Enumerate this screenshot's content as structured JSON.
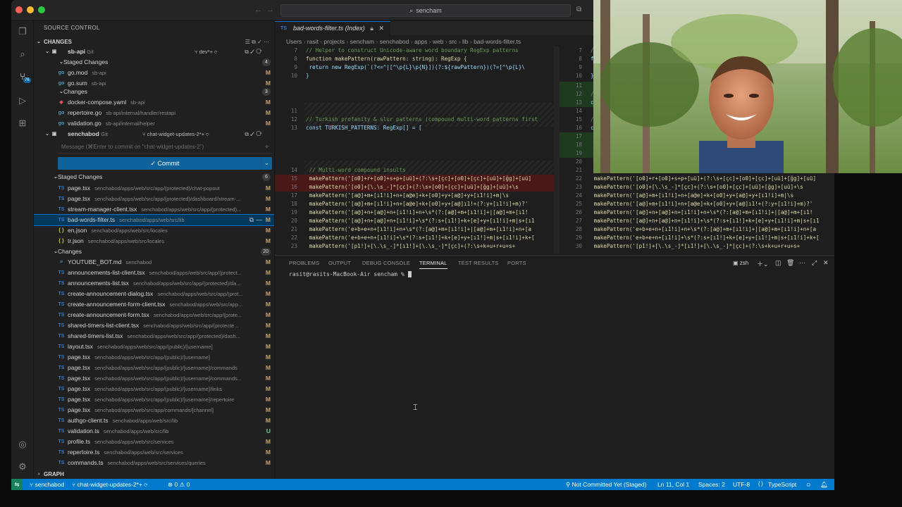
{
  "window": {
    "search_text": "sencham"
  },
  "sidebar": {
    "title": "SOURCE CONTROL",
    "changes_header": "CHANGES",
    "repos": [
      {
        "name": "sb-api",
        "kind": "Git",
        "branch": "dev*+",
        "staged_label": "Staged Changes",
        "staged_count": "4",
        "changes_label": "Changes",
        "changes_count": "3"
      },
      {
        "name": "senchabod",
        "kind": "Git",
        "branch": "chat-widget-updates-2*+",
        "staged_label": "Staged Changes",
        "staged_count": "6",
        "changes_label": "Changes",
        "changes_count": "20"
      }
    ],
    "sbapi_staged": [
      {
        "name": "go.mod",
        "path": "sb-api",
        "status": "M"
      },
      {
        "name": "go.sum",
        "path": "sb-api",
        "status": "M"
      }
    ],
    "sbapi_changes": [
      {
        "name": "docker-compose.yaml",
        "path": "sb-api",
        "status": "M"
      },
      {
        "name": "repertoire.go",
        "path": "sb-api/internal/handler/restapi",
        "status": "M"
      },
      {
        "name": "validation.go",
        "path": "sb-api/internal/helper",
        "status": "M"
      }
    ],
    "commit_placeholder": "Message (⌘Enter to commit on \"chat-widget-updates-2\")",
    "commit_button": "Commit",
    "staged": [
      {
        "name": "page.tsx",
        "path": "senchabod/apps/web/src/app/(protected)/chat-popout",
        "status": "M"
      },
      {
        "name": "page.tsx",
        "path": "senchabod/apps/web/src/app/(protected)/dashboard/stream-...",
        "status": "M"
      },
      {
        "name": "stream-manager-client.tsx",
        "path": "senchabod/apps/web/src/app/(protected)...",
        "status": "M"
      },
      {
        "name": "bad-words-filter.ts",
        "path": "senchabod/apps/web/src/lib",
        "status": "M"
      },
      {
        "name": "en.json",
        "path": "senchabod/apps/web/src/locales",
        "status": "M"
      },
      {
        "name": "tr.json",
        "path": "senchabod/apps/web/src/locales",
        "status": "M"
      }
    ],
    "changes": [
      {
        "name": "YOUTUBE_BOT.md",
        "path": "senchabod",
        "status": "M"
      },
      {
        "name": "announcements-list-client.tsx",
        "path": "senchabod/apps/web/src/app/(protect...",
        "status": "M"
      },
      {
        "name": "announcements-list.tsx",
        "path": "senchabod/apps/web/src/app/(protected)/da...",
        "status": "M"
      },
      {
        "name": "create-announcement-dialog.tsx",
        "path": "senchabod/apps/web/src/app/(prot...",
        "status": "M"
      },
      {
        "name": "create-announcement-form-client.tsx",
        "path": "senchabod/apps/web/src/app...",
        "status": "M"
      },
      {
        "name": "create-announcement-form.tsx",
        "path": "senchabod/apps/web/src/app/(prote...",
        "status": "M"
      },
      {
        "name": "shared-timers-list-client.tsx",
        "path": "senchabod/apps/web/src/app/(protecte...",
        "status": "M"
      },
      {
        "name": "shared-timers-list.tsx",
        "path": "senchabod/apps/web/src/app/(protected)/dash...",
        "status": "M"
      },
      {
        "name": "layout.tsx",
        "path": "senchabod/apps/web/src/app/(public)/[username]",
        "status": "M"
      },
      {
        "name": "page.tsx",
        "path": "senchabod/apps/web/src/app/(public)/[username]",
        "status": "M"
      },
      {
        "name": "page.tsx",
        "path": "senchabod/apps/web/src/app/(public)/[username]/commands",
        "status": "M"
      },
      {
        "name": "page.tsx",
        "path": "senchabod/apps/web/src/app/(public)/[username]/commands...",
        "status": "M"
      },
      {
        "name": "page.tsx",
        "path": "senchabod/apps/web/src/app/(public)/[username]/links",
        "status": "M"
      },
      {
        "name": "page.tsx",
        "path": "senchabod/apps/web/src/app/(public)/[username]/repertoire",
        "status": "M"
      },
      {
        "name": "page.tsx",
        "path": "senchabod/apps/web/src/app/commands/[channel]",
        "status": "M"
      },
      {
        "name": "authgo-client.ts",
        "path": "senchabod/apps/web/src/lib",
        "status": "M"
      },
      {
        "name": "validation.ts",
        "path": "senchabod/apps/web/src/lib",
        "status": "U"
      },
      {
        "name": "profile.ts",
        "path": "senchabod/apps/web/src/services",
        "status": "M"
      },
      {
        "name": "repertoire.ts",
        "path": "senchabod/apps/web/src/services",
        "status": "M"
      },
      {
        "name": "commands.ts",
        "path": "senchabod/apps/web/src/services/queries",
        "status": "M"
      }
    ],
    "graph_label": "GRAPH",
    "scm_badge": "76"
  },
  "editor": {
    "tab_title": "bad-words-filter.ts (Index)",
    "breadcrumb": [
      "Users",
      "rasit",
      "projects",
      "sencham",
      "senchabod",
      "apps",
      "web",
      "src",
      "lib",
      "bad-words-filter.ts"
    ],
    "left": [
      {
        "n": "7",
        "t": "// Helper to construct Unicode-aware word boundary RegExp patterns",
        "k": "cm"
      },
      {
        "n": "8",
        "t": "function makePattern(rawPattern: string): RegExp {",
        "k": "code"
      },
      {
        "n": "9",
        "t": "  return new RegExp(`(?<=^|[^\\p{L}\\p{N}])(?:${rawPattern})(?=[^\\p{L}\\",
        "k": "code"
      },
      {
        "n": "10",
        "t": "}",
        "k": "code"
      },
      {
        "n": "11",
        "t": "",
        "k": "code"
      },
      {
        "n": "12",
        "t": "// Turkish profanity & slur patterns (compound multi-word patterns first",
        "k": "cm"
      },
      {
        "n": "13",
        "t": "const TURKISH_PATTERNS: RegExp[] = [",
        "k": "code"
      },
      {
        "n": "14",
        "t": "  // Multi-word compound insults",
        "k": "cm"
      },
      {
        "n": "15",
        "t": "  makePattern('[o0]+r+[o0]+s+p+[uü]+(?:\\s+[çc]+[o0]+[çc]+[uü]+[ğg]+[uü]",
        "k": "del"
      },
      {
        "n": "16",
        "t": "  makePattern('[o0]+[\\.\\s_-]*[çc]+(?:\\s+[o0]+[çc]+[uü]+[ğg]+[uü]+\\s",
        "k": "del"
      },
      {
        "n": "17",
        "t": "  makePattern('[a@]+m+[ı1!i]+n+[a@e]+k+[o0]+y+[a@]+y+[ı1!i]+m|\\s",
        "k": "code"
      },
      {
        "n": "18",
        "t": "  makePattern('[a@]+m+[ı1!i]+n+[a@e]+k+[o0]+y+[a@]ı1!+(?:y+[ı1!i]+m)?'",
        "k": "code"
      },
      {
        "n": "19",
        "t": "  makePattern('[a@]+n+[a@]+n+[ı1!i]+n+\\s*(?:[a@]+m+[ı1!i]+|[a@]+m+[ı1!",
        "k": "code"
      },
      {
        "n": "20",
        "t": "  makePattern('[a@]+n+[a@]+n+[ı1!i]+\\s*(?:s+[ı1!]+k+[e]+y+[ı1!i]+m|s+[ı1",
        "k": "code"
      },
      {
        "n": "21",
        "t": "  makePattern('e+b+e+n+[ı1!i]+n+\\s*(?:[a@]+m+[ı1!i]+|[a@]+m+[ı1!i]+n+[a",
        "k": "code"
      },
      {
        "n": "22",
        "t": "  makePattern('e+b+e+n+[ı1!i]+\\s*(?:s+[ı1!]+k+[e]+y+[ı1!]+m|s+[ı1!i]+k+[",
        "k": "code"
      },
      {
        "n": "23",
        "t": "  makePattern('[p1!]+[\\.\\s_-]*[ı1!]+[\\.\\s_-]*[çc]+(?:\\s+k+u+r+u+s+",
        "k": "code"
      }
    ],
    "right": [
      {
        "n": "7",
        "t": "// Helpe",
        "k": "cm"
      },
      {
        "n": "8",
        "t": "functio",
        "k": "code"
      },
      {
        "n": "9",
        "t": "  retur",
        "k": "code"
      },
      {
        "n": "10",
        "t": "}",
        "k": "code"
      },
      {
        "n": "11",
        "t": "",
        "k": "add"
      },
      {
        "n": "12",
        "t": "// Co",
        "k": "add"
      },
      {
        "n": "13",
        "t": "const T",
        "k": "add"
      },
      {
        "n": "14",
        "t": "",
        "k": "code"
      },
      {
        "n": "15",
        "t": "// Turk",
        "k": "cm"
      },
      {
        "n": "16",
        "t": "const T",
        "k": "code"
      },
      {
        "n": "17",
        "t": "  // Ba",
        "k": "add"
      },
      {
        "n": "18",
        "t": "  makeP",
        "k": "add"
      },
      {
        "n": "19",
        "t": "  makeP",
        "k": "add"
      },
      {
        "n": "20",
        "t": "",
        "k": "code"
      },
      {
        "n": "21",
        "t": "  // Mu",
        "k": "cm"
      },
      {
        "n": "22",
        "t": "  makePattern('[o0]+r+[o0]+s+p+[uü]+(?:\\s+[çc]+[o0]+[çc]+[uü]+[ğg]+[uü]",
        "k": "code"
      },
      {
        "n": "23",
        "t": "  makePattern('[o0]+[\\.\\s_-]*[çc]+(?:\\s+[o0]+[çc]+[uü]+[ğg]+[uü]+\\s",
        "k": "code"
      },
      {
        "n": "24",
        "t": "  makePattern('[a@]+m+[ı1!i]+n+[a@e]+k+[o0]+y+[a@]+y+[ı1!i]+m|\\s",
        "k": "code"
      },
      {
        "n": "25",
        "t": "  makePattern('[a@]+m+[ı1!i]+n+[a@e]+k+[o0]+y+[a@]ı1!+(?:y+[ı1!i]+m)?'",
        "k": "code"
      },
      {
        "n": "26",
        "t": "  makePattern('[a@]+n+[a@]+n+[ı1!i]+n+\\s*(?:[a@]+m+[ı1!i]+|[a@]+m+[ı1!",
        "k": "code"
      },
      {
        "n": "27",
        "t": "  makePattern('[a@]+n+[a@]+n+[ı1!i]+\\s*(?:s+[ı1!]+k+[e]+y+[ı1!i]+m|s+[ı1",
        "k": "code"
      },
      {
        "n": "28",
        "t": "  makePattern('e+b+e+n+[ı1!i]+n+\\s*(?:[a@]+m+[ı1!i]+|[a@]+m+[ı1!i]+n+[a",
        "k": "code"
      },
      {
        "n": "29",
        "t": "  makePattern('e+b+e+n+[ı1!i]+\\s*(?:s+[ı1!]+k+[e]+y+[ı1!]+m|s+[ı1!i]+k+[",
        "k": "code"
      },
      {
        "n": "30",
        "t": "  makePattern('[p1!]+[\\.\\s_-]*[ı1!]+[\\.\\s_-]*[çc]+(?:\\s+k+u+r+u+s+",
        "k": "code"
      }
    ]
  },
  "panel": {
    "tabs": [
      "PROBLEMS",
      "OUTPUT",
      "DEBUG CONSOLE",
      "TERMINAL",
      "TEST RESULTS",
      "PORTS"
    ],
    "active_tab": "TERMINAL",
    "shell": "zsh",
    "prompt": "rasit@rasits-MacBook-Air sencham %"
  },
  "statusbar": {
    "repo": "senchabod",
    "branch": "chat-widget-updates-2*+",
    "errors": "0",
    "warnings": "0",
    "blame": "Not Committed Yet (Staged)",
    "position": "Ln 11, Col 1",
    "spaces": "Spaces: 2",
    "encoding": "UTF-8",
    "language": "TypeScript"
  },
  "colors": {
    "accent": "#007acc",
    "modified": "#c9a26d",
    "selection": "#04395e"
  }
}
